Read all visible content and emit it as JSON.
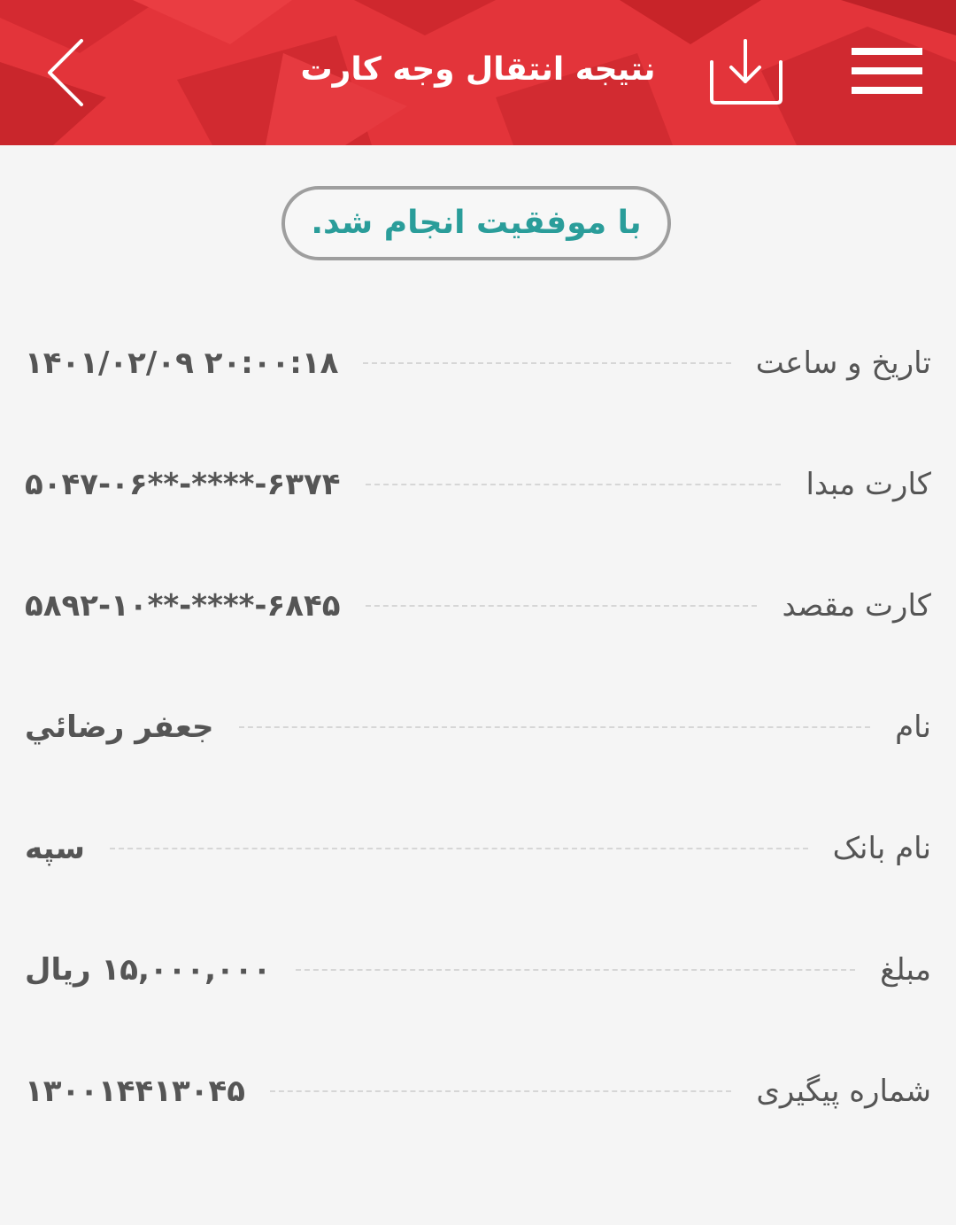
{
  "header": {
    "title": "نتیجه انتقال وجه کارت",
    "back_icon": "chevron-left-icon",
    "download_icon": "download-icon",
    "menu_icon": "hamburger-menu-icon",
    "color": "#e03138"
  },
  "status": {
    "message": "با موفقیت انجام شد.",
    "color": "#2a9d9a"
  },
  "details": [
    {
      "label": "تاریخ و ساعت",
      "value": "۱۴۰۱/۰۲/۰۹ ۲۰:۰۰:۱۸"
    },
    {
      "label": "کارت مبدا",
      "value": "۵۰۴۷-۰۶**-****-۶۳۷۴"
    },
    {
      "label": "کارت مقصد",
      "value": "۵۸۹۲-۱۰**-****-۶۸۴۵"
    },
    {
      "label": "نام",
      "value": "جعفر رضائي"
    },
    {
      "label": "نام بانک",
      "value": "سپه"
    },
    {
      "label": "مبلغ",
      "value": "۱۵,۰۰۰,۰۰۰ ریال"
    },
    {
      "label": "شماره پیگیری",
      "value": "۱۳۰۰۱۴۴۱۳۰۴۵"
    }
  ]
}
